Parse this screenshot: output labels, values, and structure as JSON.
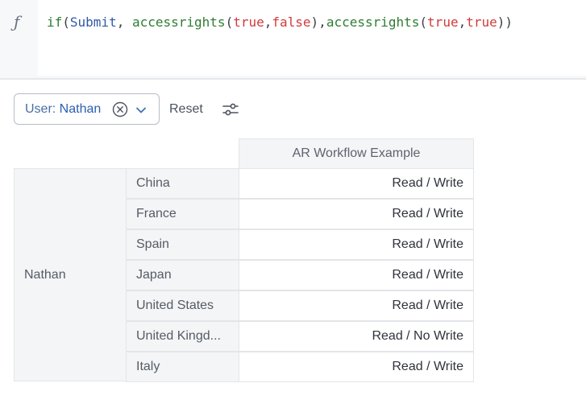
{
  "formula_bar": {
    "fx_symbol": "ƒ",
    "tokens": [
      {
        "text": "if",
        "kind": "fn"
      },
      {
        "text": "(",
        "kind": "punct"
      },
      {
        "text": "Submit",
        "kind": "ident"
      },
      {
        "text": ", ",
        "kind": "punct"
      },
      {
        "text": "accessrights",
        "kind": "fn"
      },
      {
        "text": "(",
        "kind": "punct"
      },
      {
        "text": "true",
        "kind": "bool"
      },
      {
        "text": ",",
        "kind": "punct"
      },
      {
        "text": "false",
        "kind": "bool"
      },
      {
        "text": "),",
        "kind": "punct"
      },
      {
        "text": "accessrights",
        "kind": "fn"
      },
      {
        "text": "(",
        "kind": "punct"
      },
      {
        "text": "true",
        "kind": "bool"
      },
      {
        "text": ",",
        "kind": "punct"
      },
      {
        "text": "true",
        "kind": "bool"
      },
      {
        "text": "))",
        "kind": "punct"
      }
    ]
  },
  "filter": {
    "key": "User: ",
    "value": "Nathan",
    "clear_icon": "clear-circle-icon",
    "dropdown_icon": "chevron-down-icon"
  },
  "toolbar": {
    "reset_label": "Reset",
    "settings_icon": "sliders-icon"
  },
  "pivot": {
    "column_header": "AR Workflow Example",
    "outer_row": "Nathan",
    "rows": [
      {
        "label": "China",
        "value": "Read / Write"
      },
      {
        "label": "France",
        "value": "Read / Write"
      },
      {
        "label": "Spain",
        "value": "Read / Write"
      },
      {
        "label": "Japan",
        "value": "Read / Write"
      },
      {
        "label": "United States",
        "value": "Read / Write"
      },
      {
        "label": "United Kingd...",
        "value": "Read / No Write"
      },
      {
        "label": "Italy",
        "value": "Read / Write"
      }
    ]
  },
  "colors": {
    "function": "#2e7d32",
    "identifier": "#2f5aa8",
    "boolean": "#d33a3a",
    "chip_value": "#2a5fb0"
  }
}
